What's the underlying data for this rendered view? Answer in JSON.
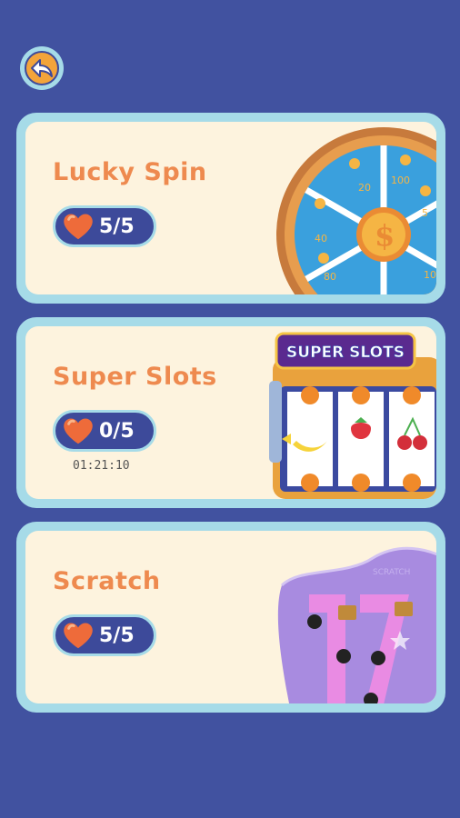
{
  "header": {
    "back_icon": "back-arrow-icon"
  },
  "colors": {
    "background": "#4152a0",
    "card_border": "#a6dbe8",
    "card_fill": "#fdf3de",
    "title": "#ee8a4f",
    "pill": "#3d4a9a",
    "heart": "#ee6b3a"
  },
  "games": [
    {
      "title": "Lucky Spin",
      "lives": "5/5",
      "timer": ""
    },
    {
      "title": "Super Slots",
      "lives": "0/5",
      "timer": "01:21:10"
    },
    {
      "title": "Scratch",
      "lives": "5/5",
      "timer": ""
    }
  ],
  "wheel": {
    "labels": [
      "20",
      "100",
      "5",
      "40",
      "10",
      "80"
    ],
    "center_symbol": "$"
  },
  "slots": {
    "sign_text": "SUPER SLOTS",
    "symbols": [
      "orange",
      "banana",
      "strawberry",
      "cherry",
      "orange"
    ]
  },
  "scratch": {
    "pattern_text": "SCRATCH"
  }
}
